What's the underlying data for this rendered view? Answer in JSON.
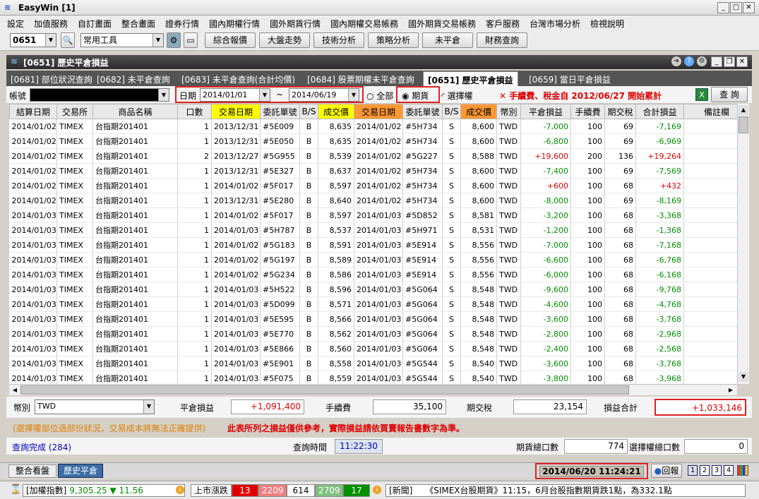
{
  "app": {
    "title": "EasyWin  [1]"
  },
  "menu": [
    "設定",
    "加值服務",
    "自訂畫面",
    "整合畫面",
    "證券行情",
    "國內期權行情",
    "國外期貨行情",
    "國內期權交易帳務",
    "國外期貨交易帳務",
    "客戶服務",
    "台灣市場分析",
    "檢視說明"
  ],
  "toolbar": {
    "code": "0651",
    "tool_select": "常用工具",
    "buttons": [
      "綜合報價",
      "大盤走勢",
      "技術分析",
      "策略分析",
      "未平倉",
      "財務查詢"
    ]
  },
  "panel": {
    "title": "[0651] 歷史平倉損益"
  },
  "tabs": [
    "[0681] 部位狀況查詢",
    "[0682] 未平倉查詢",
    "[0683] 未平倉查詢(合計均價)",
    "[0684] 股票期權未平倉查詢",
    "[0651] 歷史平倉損益",
    "[0659] 當日平倉損益"
  ],
  "filter": {
    "account_label": "帳號",
    "date_label": "日期",
    "date_from": "2014/01/01",
    "tilde": "~",
    "date_to": "2014/06/19",
    "opt_all": "全部",
    "opt_futures": "期貨",
    "opt_options": "選擇權",
    "notice": "✕ 手續費、稅金自 2012/06/27 開始累計",
    "query_btn": "查 詢"
  },
  "columns": [
    "結算日期",
    "交易所",
    "商品名稱",
    "口數",
    "交易日期",
    "委託單號",
    "B/S",
    "成交價",
    "交易日期",
    "委託單號",
    "B/S",
    "成交價",
    "幣別",
    "平倉損益",
    "手續費",
    "期交稅",
    "合計損益",
    "備註欄"
  ],
  "rows": [
    [
      "2014/01/02",
      "TIMEX",
      "台指期201401",
      "1",
      "2013/12/31",
      "#5E009",
      "B",
      "8,635",
      "2014/01/02",
      "#5H734",
      "S",
      "8,600",
      "TWD",
      "-7,000",
      "100",
      "69",
      "-7,169",
      ""
    ],
    [
      "2014/01/02",
      "TIMEX",
      "台指期201401",
      "1",
      "2013/12/31",
      "#5E050",
      "B",
      "8,635",
      "2014/01/02",
      "#5H734",
      "S",
      "8,600",
      "TWD",
      "-6,800",
      "100",
      "69",
      "-6,969",
      ""
    ],
    [
      "2014/01/02",
      "TIMEX",
      "台指期201401",
      "2",
      "2013/12/27",
      "#5G955",
      "B",
      "8,539",
      "2014/01/02",
      "#5G227",
      "S",
      "8,588",
      "TWD",
      "+19,600",
      "200",
      "136",
      "+19,264",
      ""
    ],
    [
      "2014/01/02",
      "TIMEX",
      "台指期201401",
      "1",
      "2013/12/31",
      "#5E327",
      "B",
      "8,637",
      "2014/01/02",
      "#5H734",
      "S",
      "8,600",
      "TWD",
      "-7,400",
      "100",
      "69",
      "-7,569",
      ""
    ],
    [
      "2014/01/02",
      "TIMEX",
      "台指期201401",
      "1",
      "2014/01/02",
      "#5F017",
      "B",
      "8,597",
      "2014/01/02",
      "#5H734",
      "S",
      "8,600",
      "TWD",
      "+600",
      "100",
      "68",
      "+432",
      ""
    ],
    [
      "2014/01/02",
      "TIMEX",
      "台指期201401",
      "1",
      "2013/12/31",
      "#5E280",
      "B",
      "8,640",
      "2014/01/02",
      "#5H734",
      "S",
      "8,600",
      "TWD",
      "-8,000",
      "100",
      "69",
      "-8,169",
      ""
    ],
    [
      "2014/01/03",
      "TIMEX",
      "台指期201401",
      "1",
      "2014/01/02",
      "#5F017",
      "B",
      "8,597",
      "2014/01/03",
      "#5D852",
      "S",
      "8,581",
      "TWD",
      "-3,200",
      "100",
      "68",
      "-3,368",
      ""
    ],
    [
      "2014/01/03",
      "TIMEX",
      "台指期201401",
      "1",
      "2014/01/03",
      "#5H787",
      "B",
      "8,537",
      "2014/01/03",
      "#5H971",
      "S",
      "8,531",
      "TWD",
      "-1,200",
      "100",
      "68",
      "-1,368",
      ""
    ],
    [
      "2014/01/03",
      "TIMEX",
      "台指期201401",
      "1",
      "2014/01/02",
      "#5G183",
      "B",
      "8,591",
      "2014/01/03",
      "#5E914",
      "S",
      "8,556",
      "TWD",
      "-7,000",
      "100",
      "68",
      "-7,168",
      ""
    ],
    [
      "2014/01/03",
      "TIMEX",
      "台指期201401",
      "1",
      "2014/01/02",
      "#5G197",
      "B",
      "8,589",
      "2014/01/03",
      "#5E914",
      "S",
      "8,556",
      "TWD",
      "-6,600",
      "100",
      "68",
      "-6,768",
      ""
    ],
    [
      "2014/01/03",
      "TIMEX",
      "台指期201401",
      "1",
      "2014/01/02",
      "#5G234",
      "B",
      "8,586",
      "2014/01/03",
      "#5E914",
      "S",
      "8,556",
      "TWD",
      "-6,000",
      "100",
      "68",
      "-6,168",
      ""
    ],
    [
      "2014/01/03",
      "TIMEX",
      "台指期201401",
      "1",
      "2014/01/03",
      "#5H522",
      "B",
      "8,596",
      "2014/01/03",
      "#5G064",
      "S",
      "8,548",
      "TWD",
      "-9,600",
      "100",
      "68",
      "-9,768",
      ""
    ],
    [
      "2014/01/03",
      "TIMEX",
      "台指期201401",
      "1",
      "2014/01/03",
      "#5D099",
      "B",
      "8,571",
      "2014/01/03",
      "#5G064",
      "S",
      "8,548",
      "TWD",
      "-4,600",
      "100",
      "68",
      "-4,768",
      ""
    ],
    [
      "2014/01/03",
      "TIMEX",
      "台指期201401",
      "1",
      "2014/01/03",
      "#5E595",
      "B",
      "8,566",
      "2014/01/03",
      "#5G064",
      "S",
      "8,548",
      "TWD",
      "-3,600",
      "100",
      "68",
      "-3,768",
      ""
    ],
    [
      "2014/01/03",
      "TIMEX",
      "台指期201401",
      "1",
      "2014/01/03",
      "#5E770",
      "B",
      "8,562",
      "2014/01/03",
      "#5G064",
      "S",
      "8,548",
      "TWD",
      "-2,800",
      "100",
      "68",
      "-2,968",
      ""
    ],
    [
      "2014/01/03",
      "TIMEX",
      "台指期201401",
      "1",
      "2014/01/03",
      "#5E866",
      "B",
      "8,560",
      "2014/01/03",
      "#5G064",
      "S",
      "8,548",
      "TWD",
      "-2,400",
      "100",
      "68",
      "-2,568",
      ""
    ],
    [
      "2014/01/03",
      "TIMEX",
      "台指期201401",
      "1",
      "2014/01/03",
      "#5E901",
      "B",
      "8,558",
      "2014/01/03",
      "#5G544",
      "S",
      "8,540",
      "TWD",
      "-3,600",
      "100",
      "68",
      "-3,768",
      ""
    ],
    [
      "2014/01/03",
      "TIMEX",
      "台指期201401",
      "1",
      "2014/01/03",
      "#5F075",
      "B",
      "8,559",
      "2014/01/03",
      "#5G544",
      "S",
      "8,540",
      "TWD",
      "-3,800",
      "100",
      "68",
      "-3,968",
      ""
    ]
  ],
  "summary": {
    "currency_label": "幣別",
    "currency": "TWD",
    "pnl_label": "平倉損益",
    "pnl": "+1,091,400",
    "fee_label": "手續費",
    "fee": "35,100",
    "tax_label": "期交稅",
    "tax": "23,154",
    "total_label": "損益合計",
    "total": "+1,033,146"
  },
  "notes": {
    "left": "(選擇權部位過部份狀況，交易成本將無法正確提供)",
    "right": "此表所列之損益僅供參考，實際損益請依買賣報告書數字為準。"
  },
  "status": {
    "query_done": "查詢完成 (284)",
    "query_time_label": "查詢時間",
    "query_time": "11:22:30",
    "fut_count_label": "期貨總口數",
    "fut_count": "774",
    "opt_count_label": "選擇權總口數",
    "opt_count": "0"
  },
  "bottom": {
    "tab1": "整合看盤",
    "tab2": "歷史平倉",
    "datetime": "2014/06/20 11:24:21",
    "reply": "回報",
    "pages": [
      "1",
      "2",
      "3",
      "4"
    ]
  },
  "ticker": {
    "index_label": "[加權指數]",
    "index": "9,305.25",
    "arrow": "▼",
    "change": "11.56",
    "updown_label": "上市漲跌",
    "up_limit": "13",
    "up": "2209",
    "flat": "614",
    "down": "2709",
    "down_limit": "17",
    "news_label": "[新聞]",
    "news": "《SIMEX台股期貨》11:15，6月台股指數期貨跌1點，為332.1點"
  },
  "colors": {
    "positive": "#e00000",
    "negative": "#009000",
    "highlight_yellow": "#ffff00",
    "highlight_orange": "#ff9933",
    "red_box": "#e02020"
  }
}
